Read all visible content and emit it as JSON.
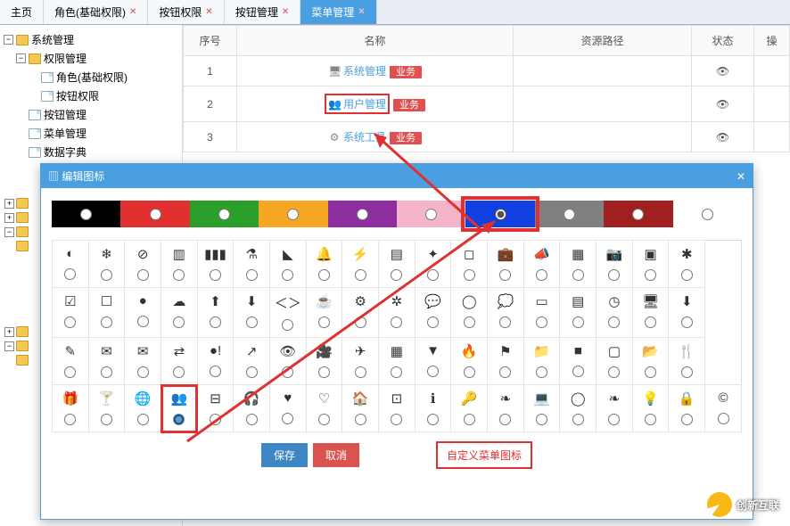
{
  "tabs": [
    {
      "label": "主页"
    },
    {
      "label": "角色(基础权限)"
    },
    {
      "label": "按钮权限"
    },
    {
      "label": "按钮管理"
    },
    {
      "label": "菜单管理",
      "active": true
    }
  ],
  "tree": {
    "root": "系统管理",
    "perm": "权限管理",
    "role": "角色(基础权限)",
    "btnperm": "按钮权限",
    "btnmgr": "按钮管理",
    "menumgr": "菜单管理",
    "dict": "数据字典"
  },
  "table": {
    "headers": {
      "no": "序号",
      "name": "名称",
      "path": "资源路径",
      "status": "状态",
      "op": "操"
    },
    "rows": [
      {
        "no": "1",
        "icon": "🖥",
        "name": "系统管理",
        "badge": "业务"
      },
      {
        "no": "2",
        "icon": "👥",
        "name": "用户管理",
        "badge": "业务",
        "hl": true
      },
      {
        "no": "3",
        "icon": "⚙",
        "name": "系统工具",
        "badge": "业务"
      }
    ]
  },
  "dialog": {
    "title": "编辑图标",
    "colors": [
      "#000000",
      "#e03030",
      "#2aa02a",
      "#f5a623",
      "#8e2da0",
      "#f5b5c8",
      "#1040e0",
      "#808080",
      "#a02020",
      "#ffffff"
    ],
    "selected_color_index": 6,
    "selected_icon": "users",
    "save": "保存",
    "cancel": "取消",
    "note": "自定义菜单图标"
  },
  "logo": "创新互联",
  "chart_data": {
    "type": "table",
    "note": "icon picker grid; rows list icon semantic names",
    "rows": [
      [
        "adjust",
        "snow",
        "ban",
        "bar-chart",
        "barcode",
        "beaker",
        "bullhorn",
        "bell",
        "bolt",
        "book",
        "bookmark",
        "bookmark-o",
        "briefcase",
        "horn",
        "calendar",
        "camera",
        "camera-retro",
        "cog-grid"
      ],
      [
        "check-sq",
        "square-o",
        "circle",
        "cloud",
        "cloud-up",
        "cloud-down",
        "code",
        "coffee",
        "cog",
        "cogs",
        "comment",
        "comment-o",
        "comments",
        "credit-card",
        "id-card",
        "dashboard",
        "desktop",
        "download"
      ],
      [
        "edit",
        "envelope",
        "envelope-o",
        "exchange",
        "exclaim",
        "external",
        "eye",
        "film",
        "plane",
        "th",
        "filter",
        "fire",
        "flag",
        "folder-c",
        "folder",
        "folder-o",
        "folder-open",
        "cutlery"
      ],
      [
        "gift",
        "glass",
        "globe",
        "users",
        "hdd",
        "headphones",
        "heart",
        "heart-o",
        "home",
        "inbox",
        "info",
        "key",
        "leaf",
        "laptop",
        "lemon",
        "leaf-o",
        "lightbulb",
        "lock",
        "cc"
      ]
    ]
  }
}
